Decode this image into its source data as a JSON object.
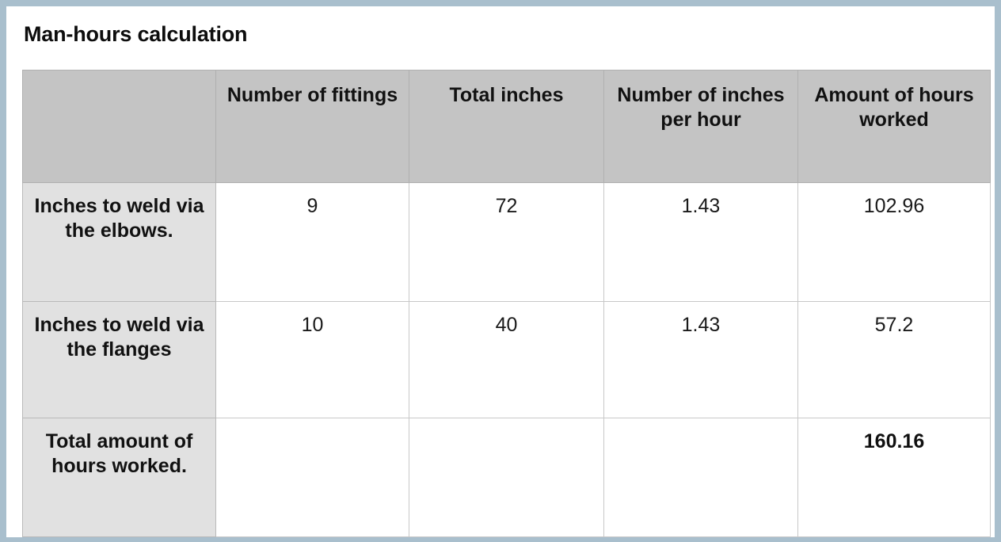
{
  "document": {
    "title": "Man-hours calculation",
    "frame_color": "#a9bfcd",
    "sheet_color": "#ffffff"
  },
  "table": {
    "header_fill": "#c4c4c4",
    "rowhead_fill": "#e1e1e1",
    "cell_fill": "#ffffff",
    "border_color": "#b9b9b9",
    "columns": [
      {
        "key": "label",
        "label": ""
      },
      {
        "key": "fittings",
        "label": "Number of fittings"
      },
      {
        "key": "total_inches",
        "label": "Total inches"
      },
      {
        "key": "inches_hour",
        "label": "Number of inches per hour"
      },
      {
        "key": "hours",
        "label": "Amount of hours worked"
      }
    ],
    "rows": [
      {
        "label": "Inches to weld via the elbows.",
        "fittings": "9",
        "total_inches": "72",
        "inches_hour": "1.43",
        "hours": "102.96",
        "hours_bold": false
      },
      {
        "label": "Inches to weld via the flanges",
        "fittings": "10",
        "total_inches": "40",
        "inches_hour": "1.43",
        "hours": "57.2",
        "hours_bold": false
      },
      {
        "label": "Total amount of hours worked.",
        "fittings": "",
        "total_inches": "",
        "inches_hour": "",
        "hours": "160.16",
        "hours_bold": true
      }
    ]
  }
}
